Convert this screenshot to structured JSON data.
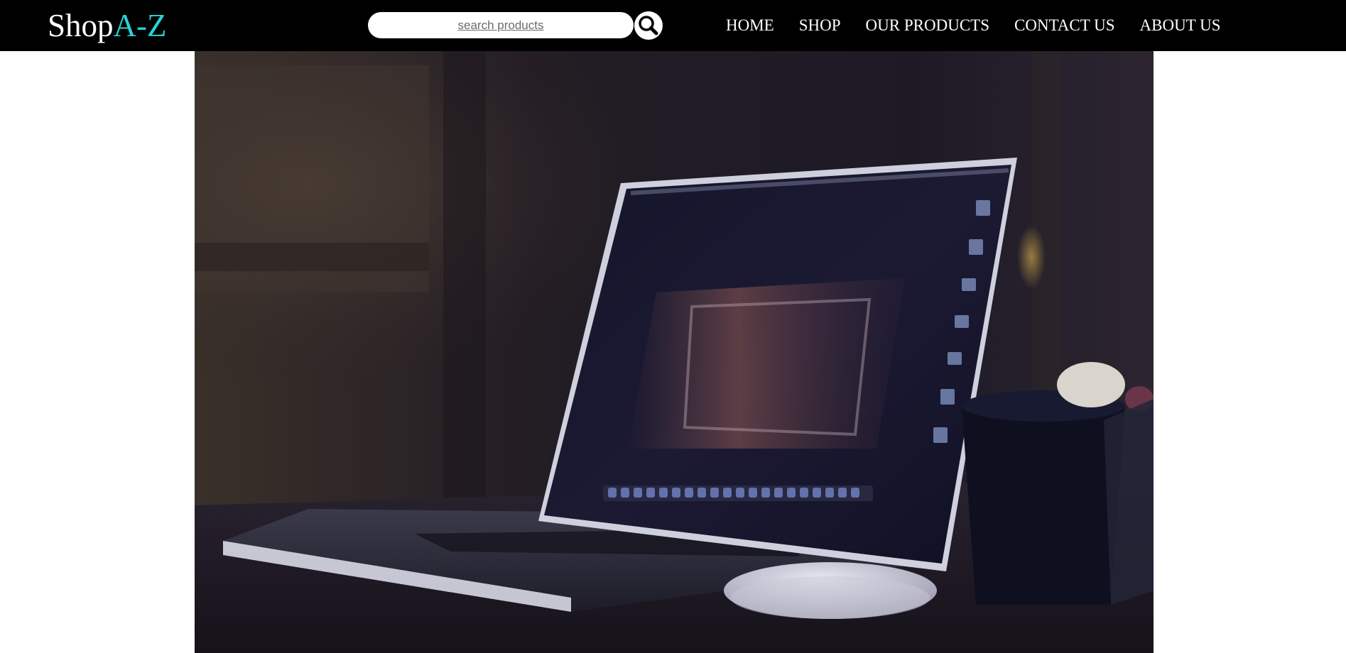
{
  "header": {
    "logo_main": "Shop",
    "logo_accent": "A-Z",
    "search_placeholder": "search products",
    "search_icon": "magnifier-icon",
    "nav": [
      {
        "label": "HOME"
      },
      {
        "label": "SHOP"
      },
      {
        "label": "OUR PRODUCTS"
      },
      {
        "label": "CONTACT US"
      },
      {
        "label": "ABOUT US"
      }
    ]
  },
  "hero": {
    "image": "laptop-on-desk-photo"
  },
  "colors": {
    "navbar_bg": "#000000",
    "logo_accent": "#27d3d6",
    "text": "#ffffff"
  }
}
